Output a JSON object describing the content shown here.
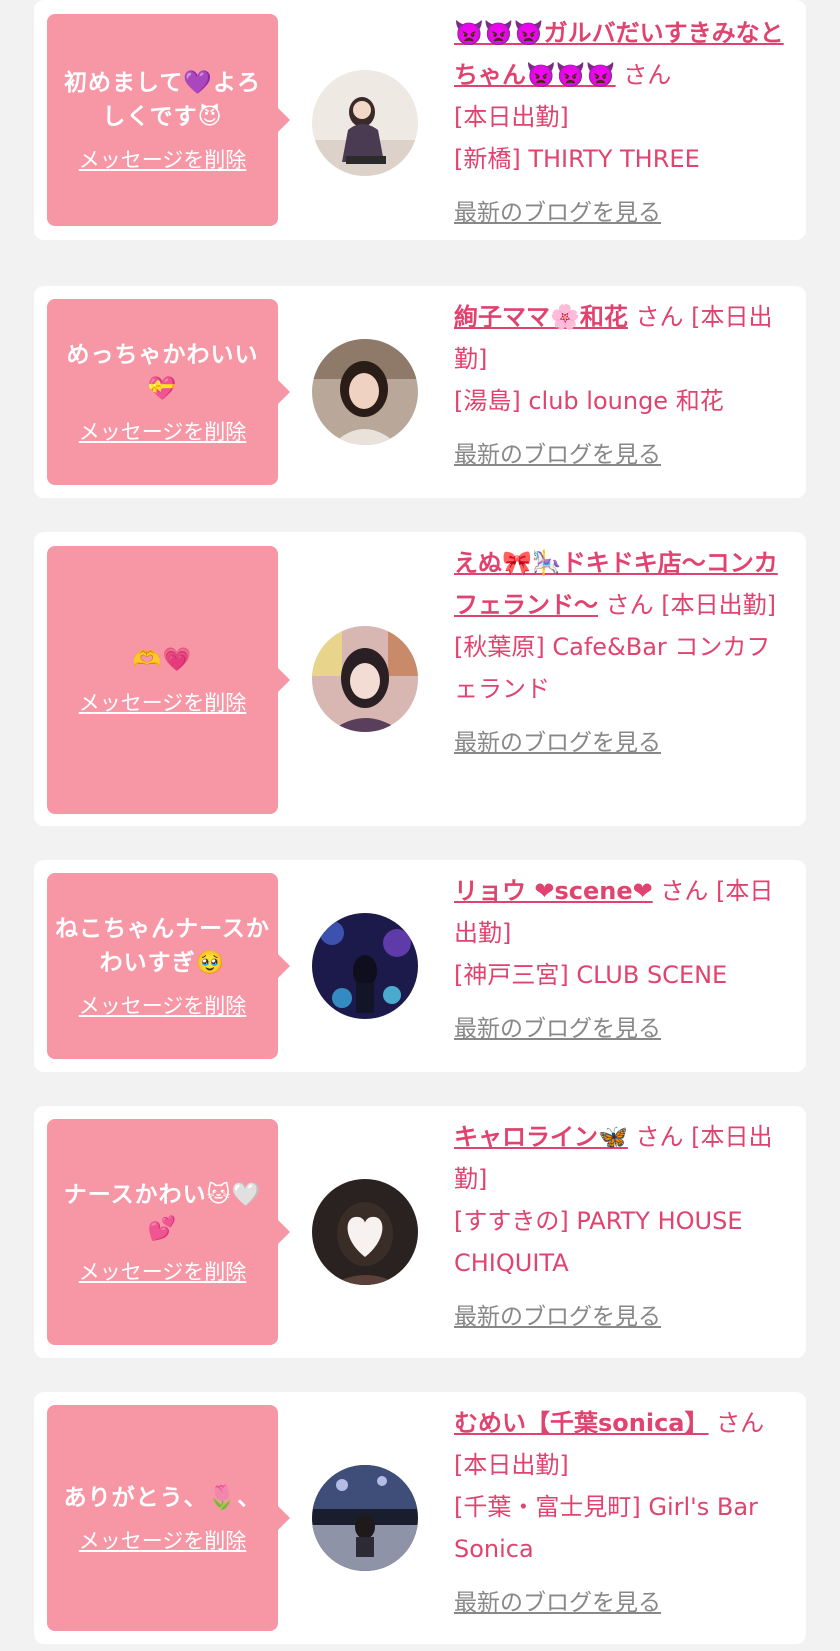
{
  "common": {
    "delete_label": "メッセージを削除",
    "blog_label": "最新のブログを見る",
    "san": "さん"
  },
  "cards": [
    {
      "message": "初めまして💜よろしくです😈",
      "name": "👿👿👿ガルバだいすきみなとちゃん👿👿👿",
      "status": "[本日出勤]",
      "shop": "[新橋] THIRTY THREE"
    },
    {
      "message": "めっちゃかわいい💝",
      "name": "絢子ママ🌸和花",
      "status": "[本日出勤]",
      "shop": "[湯島] club lounge 和花"
    },
    {
      "message": "🫶💗",
      "name": "えぬ🎀🎠ドキドキ店〜コンカフェランド〜",
      "status": "[本日出勤]",
      "shop": "[秋葉原] Cafe&Bar コンカフェランド"
    },
    {
      "message": "ねこちゃんナースかわいすぎ🥹",
      "name": "リョウ ❤scene❤",
      "status": "[本日出勤]",
      "shop": "[神戸三宮] CLUB SCENE"
    },
    {
      "message": "ナースかわい🐱🤍💕",
      "name": "キャロライン🦋",
      "status": "[本日出勤]",
      "shop": "[すすきの] PARTY HOUSE CHIQUITA"
    },
    {
      "message": "ありがとう、🌷、",
      "name": "むめい【千葉sonica】",
      "status": "[本日出勤]",
      "shop": "[千葉・富士見町] Girl's Bar Sonica"
    }
  ],
  "colors": {
    "bubble": "#f797a6",
    "accent": "#e0436f",
    "link_gray": "#888888",
    "background": "#f2f2f2"
  }
}
